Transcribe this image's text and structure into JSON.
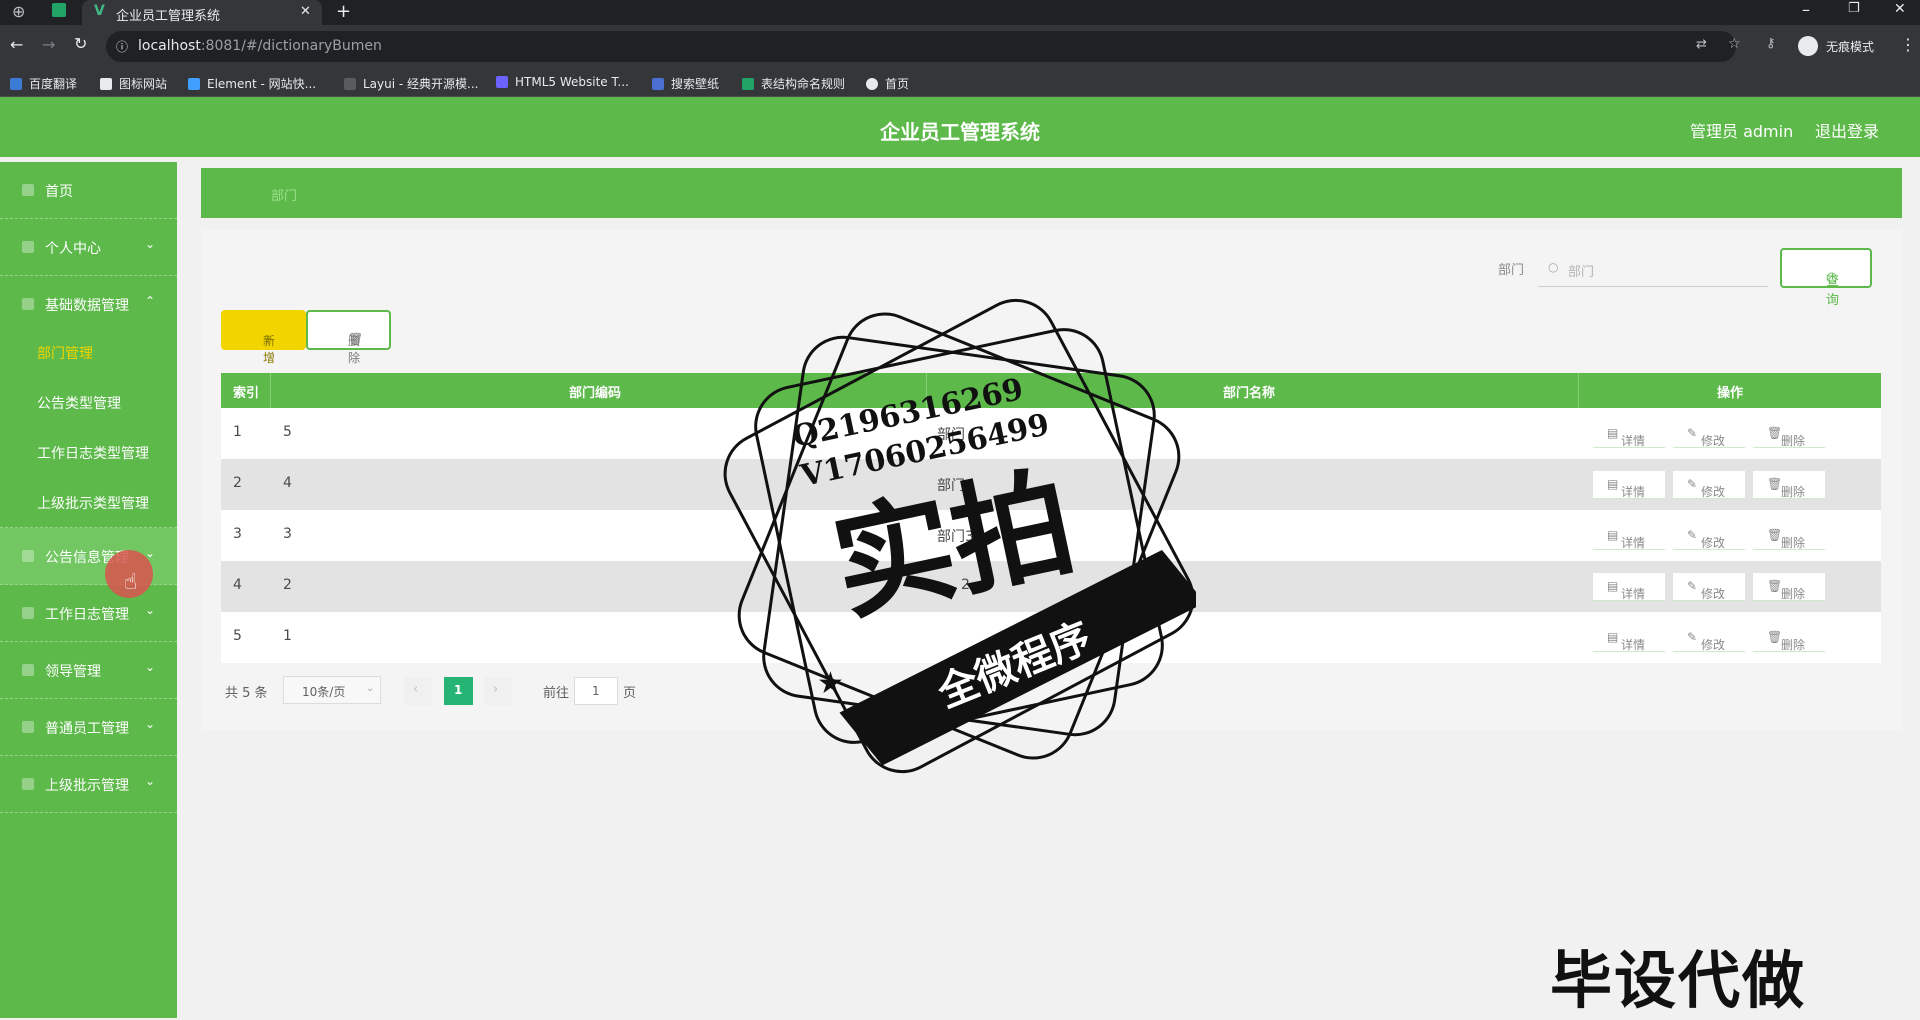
{
  "browser": {
    "tab_title": "企业员工管理系统",
    "url_host": "localhost",
    "url_rest": ":8081/#/dictionaryBumen",
    "incognito_label": "无痕模式",
    "bookmarks": [
      "百度翻译",
      "图标网站",
      "Element - 网站快...",
      "Layui - 经典开源模...",
      "HTML5 Website T...",
      "搜索壁纸",
      "表结构命名规则",
      "首页"
    ]
  },
  "header": {
    "title": "企业员工管理系统",
    "user": "管理员 admin",
    "logout": "退出登录"
  },
  "sidebar": {
    "items": [
      {
        "label": "首页"
      },
      {
        "label": "个人中心"
      },
      {
        "label": "基础数据管理"
      },
      {
        "label": "公告信息管理"
      },
      {
        "label": "工作日志管理"
      },
      {
        "label": "领导管理"
      },
      {
        "label": "普通员工管理"
      },
      {
        "label": "上级批示管理"
      }
    ],
    "sub_items": [
      {
        "label": "部门管理"
      },
      {
        "label": "公告类型管理"
      },
      {
        "label": "工作日志类型管理"
      },
      {
        "label": "上级批示类型管理"
      }
    ]
  },
  "breadcrumb": {
    "text": "部门"
  },
  "search": {
    "label": "部门",
    "placeholder": "部门",
    "button": "查询"
  },
  "toolbar": {
    "add": "新增",
    "delete": "删除"
  },
  "table": {
    "headers": [
      "索引",
      "部门编码",
      "部门名称",
      "操作"
    ],
    "rows": [
      {
        "index": "1",
        "code": "5",
        "name": "部门"
      },
      {
        "index": "2",
        "code": "4",
        "name": "部门"
      },
      {
        "index": "3",
        "code": "3",
        "name": "部门3"
      },
      {
        "index": "4",
        "code": "2",
        "name": "2"
      },
      {
        "index": "5",
        "code": "1",
        "name": ""
      }
    ],
    "actions": {
      "detail": "详情",
      "edit": "修改",
      "delete": "删除"
    }
  },
  "pagination": {
    "total": "共 5 条",
    "page_size": "10条/页",
    "current": "1",
    "goto_label": "前往",
    "goto_value": "1",
    "page_suffix": "页"
  },
  "watermark": {
    "line1": "Q2196316269",
    "line2": "V17060256499",
    "main": "实拍",
    "banner": "全微程序",
    "bottom": "毕设代做"
  },
  "colors": {
    "primary": "#5cb94a",
    "add": "#f2d400",
    "page_active": "#25b474"
  }
}
